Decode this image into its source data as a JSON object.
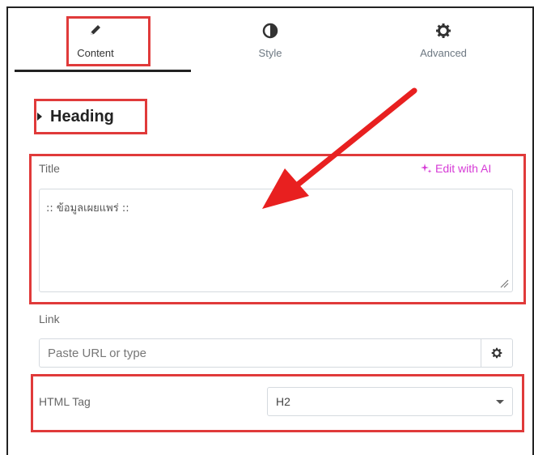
{
  "tabs": [
    {
      "label": "Content",
      "icon": "pencil-icon"
    },
    {
      "label": "Style",
      "icon": "contrast-icon"
    },
    {
      "label": "Advanced",
      "icon": "gear-icon"
    }
  ],
  "section": {
    "title": "Heading"
  },
  "title_field": {
    "label": "Title",
    "edit_ai_label": "Edit with AI",
    "value": ":: ข้อมูลเผยแพร่ ::"
  },
  "link_field": {
    "label": "Link",
    "placeholder": "Paste URL or type"
  },
  "html_tag_field": {
    "label": "HTML Tag",
    "value": "H2"
  },
  "colors": {
    "highlight": "#e03a3a",
    "ai_accent": "#d63bd6",
    "arrow": "#e82020"
  }
}
